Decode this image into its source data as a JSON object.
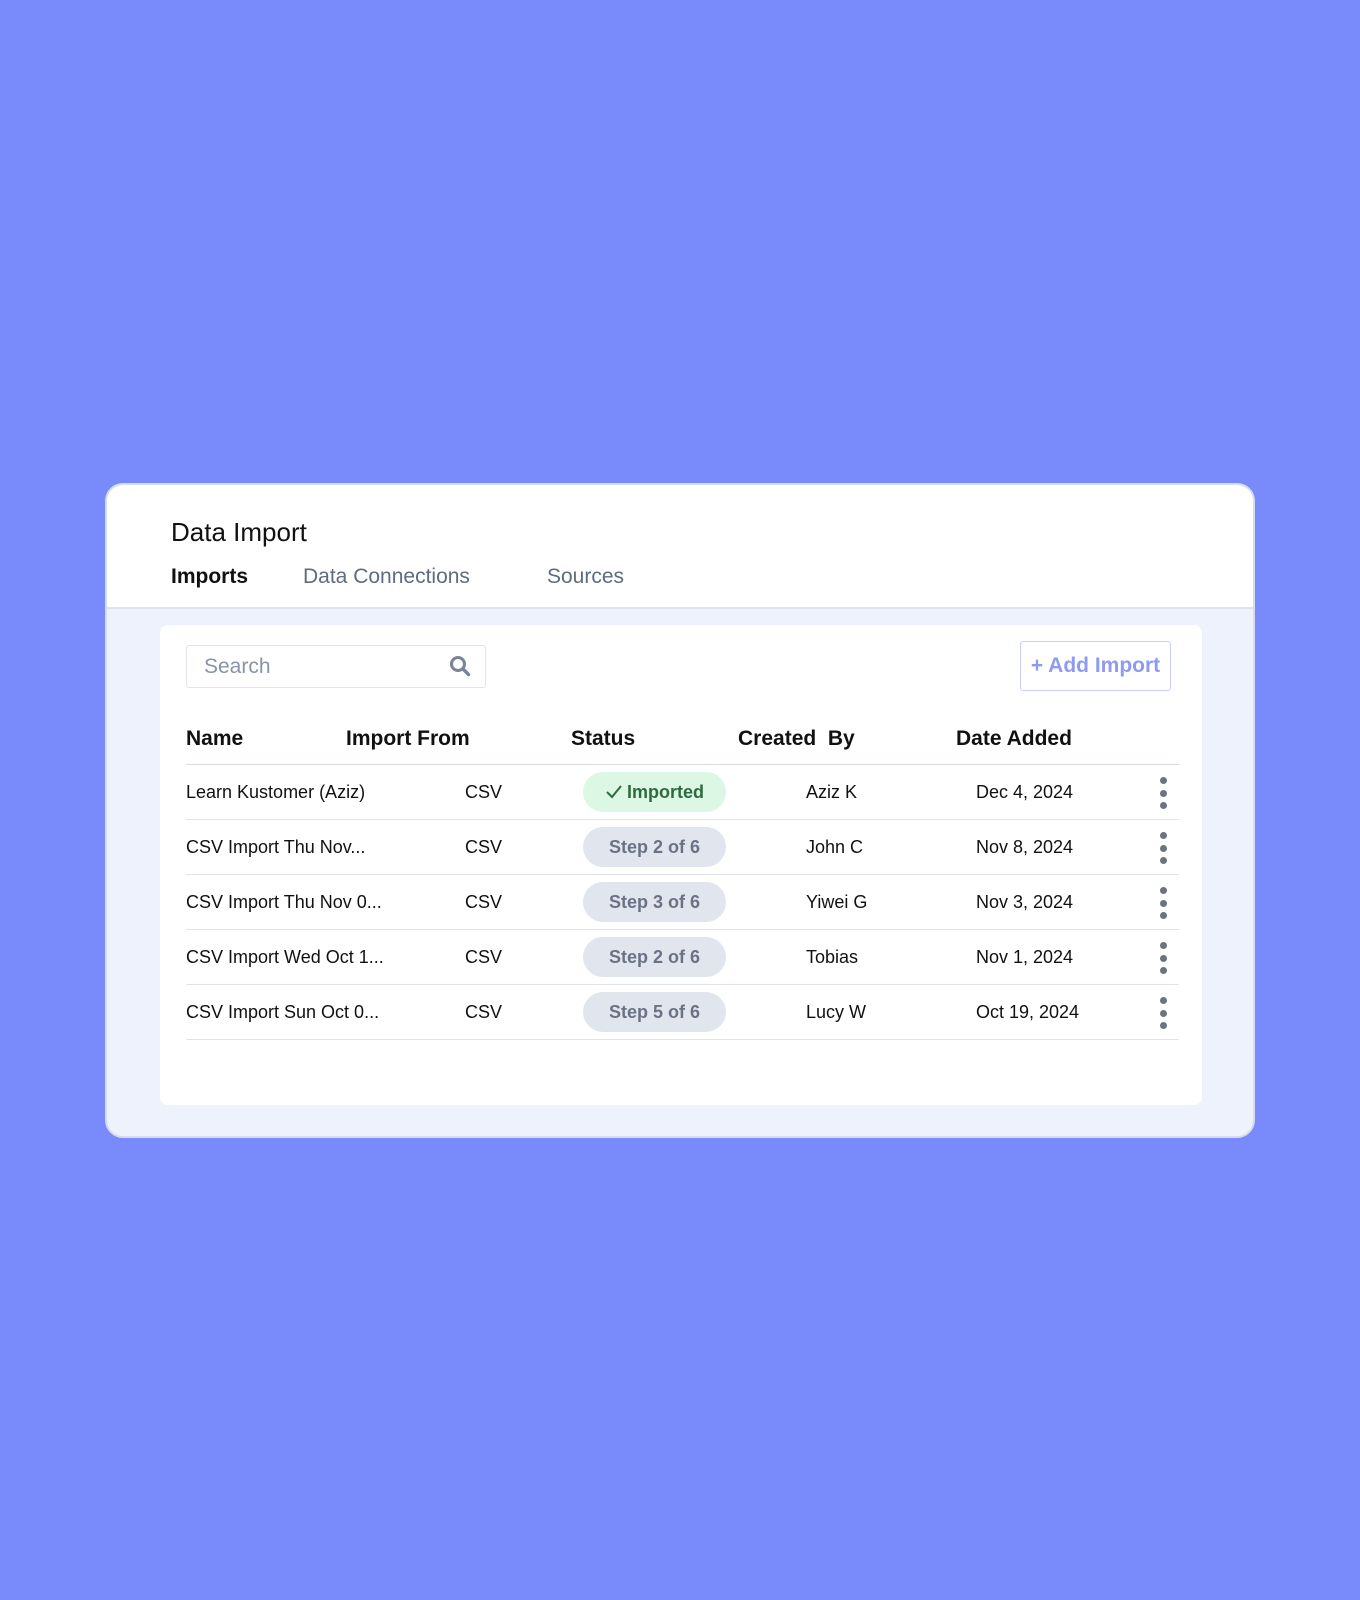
{
  "header": {
    "title": "Data Import",
    "tabs": [
      {
        "label": "Imports",
        "active": true
      },
      {
        "label": "Data Connections",
        "active": false
      },
      {
        "label": "Sources",
        "active": false
      }
    ]
  },
  "toolbar": {
    "search_placeholder": "Search",
    "search_value": "",
    "add_label": "+ Add Import"
  },
  "table": {
    "columns": [
      "Name",
      "Import From",
      "Status",
      "Created  By",
      "Date Added"
    ],
    "rows": [
      {
        "name": "Learn Kustomer (Aziz)",
        "from": "CSV",
        "status": "Imported",
        "status_kind": "done",
        "created_by": "Aziz K",
        "date": "Dec 4, 2024"
      },
      {
        "name": "CSV Import Thu Nov...",
        "from": "CSV",
        "status": "Step 2 of 6",
        "status_kind": "step",
        "created_by": "John C",
        "date": "Nov 8, 2024"
      },
      {
        "name": "CSV Import Thu Nov 0...",
        "from": "CSV",
        "status": "Step 3 of 6",
        "status_kind": "step",
        "created_by": "Yiwei G",
        "date": "Nov 3, 2024"
      },
      {
        "name": "CSV Import Wed Oct 1...",
        "from": "CSV",
        "status": "Step 2 of 6",
        "status_kind": "step",
        "created_by": "Tobias",
        "date": "Nov 1, 2024"
      },
      {
        "name": "CSV Import Sun Oct 0...",
        "from": "CSV",
        "status": "Step 5 of 6",
        "status_kind": "step",
        "created_by": "Lucy W",
        "date": "Oct 19, 2024"
      }
    ]
  },
  "colors": {
    "background": "#798bfb",
    "accent": "#8f9bf3",
    "imported_bg": "#dcf7e3",
    "imported_text": "#2f6b3d",
    "step_bg": "#e1e5ed",
    "step_text": "#6a7386"
  }
}
